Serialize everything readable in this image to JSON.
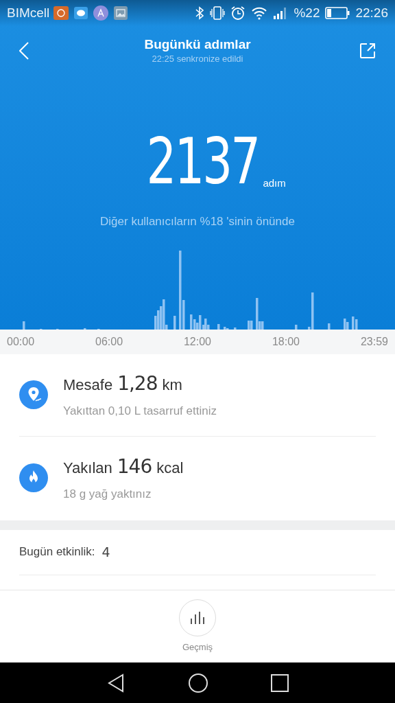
{
  "status_bar": {
    "carrier": "BIMcell",
    "battery_text": "%22",
    "time": "22:26"
  },
  "header": {
    "title": "Bugünkü adımlar",
    "subtitle": "22:25 senkronize edildi"
  },
  "steps": {
    "value": "2137",
    "unit": "adım",
    "ranking": "Diğer kullanıcıların %18 'sinin önünde"
  },
  "chart": {
    "time_labels": [
      "00:00",
      "06:00",
      "12:00",
      "18:00",
      "23:59"
    ]
  },
  "stats": [
    {
      "kind": "distance",
      "label": "Mesafe",
      "value": "1,28",
      "unit": "km",
      "note": "Yakıttan 0,10 L tasarruf ettiniz"
    },
    {
      "kind": "calories",
      "label": "Yakılan",
      "value": "146",
      "unit": "kcal",
      "note": "18 g yağ yaktınız"
    }
  ],
  "activity": {
    "label": "Bugün etkinlik:",
    "value": "4"
  },
  "history_button": {
    "label": "Geçmiş"
  }
}
